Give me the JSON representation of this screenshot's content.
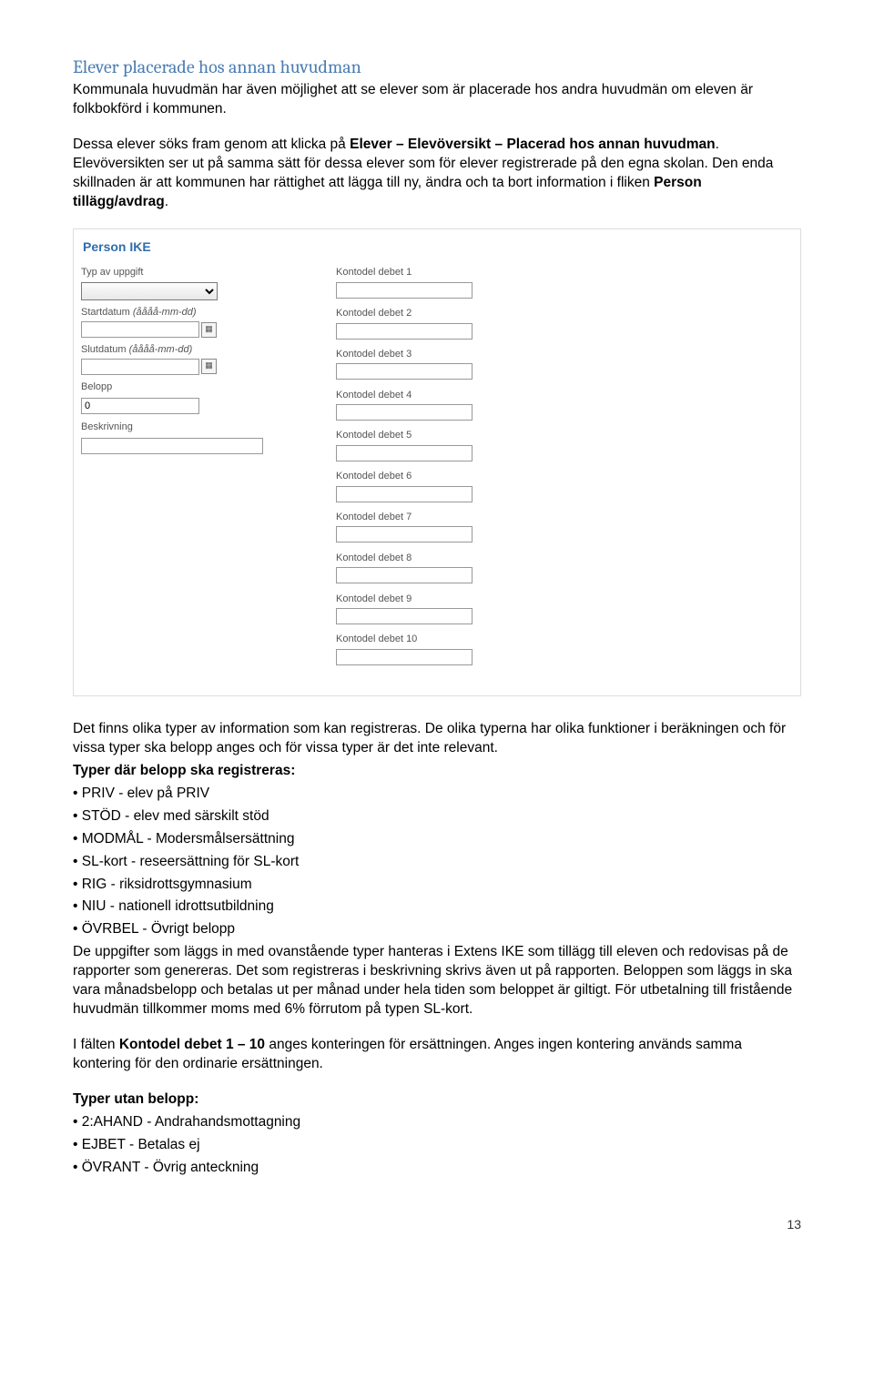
{
  "heading": "Elever placerade hos annan huvudman",
  "intro": "Kommunala huvudmän har även möjlighet att se elever som är placerade hos andra huvudmän om eleven är folkbokförd i kommunen.",
  "para_instructions_1": "Dessa elever söks fram genom att klicka på ",
  "para_instructions_bold": "Elever – Elevöversikt – Placerad hos annan huvudman",
  "para_instructions_2": ". Elevöversikten ser ut på samma sätt för dessa elever som för elever registrerade på den egna skolan. Den enda skillnaden är att kommunen har rättighet att lägga till ny, ändra och ta bort information i fliken ",
  "para_instructions_bold2": "Person tillägg/avdrag",
  "para_instructions_3": ".",
  "form": {
    "title": "Person IKE",
    "left": {
      "typ_label": "Typ av uppgift",
      "start_label": "Startdatum",
      "start_hint": "(åååå-mm-dd)",
      "slut_label": "Slutdatum",
      "slut_hint": "(åååå-mm-dd)",
      "belopp_label": "Belopp",
      "belopp_value": "0",
      "beskr_label": "Beskrivning"
    },
    "right_labels": [
      "Kontodel debet 1",
      "Kontodel debet 2",
      "Kontodel debet 3",
      "Kontodel debet 4",
      "Kontodel debet 5",
      "Kontodel debet 6",
      "Kontodel debet 7",
      "Kontodel debet 8",
      "Kontodel debet 9",
      "Kontodel debet 10"
    ]
  },
  "body1": "Det finns olika typer av information som kan registreras. De olika typerna har olika funktioner i beräkningen och för vissa typer ska belopp anges och för vissa typer är det inte relevant.",
  "body2_bold": "Typer där belopp ska registreras:",
  "bullets1": [
    "• PRIV - elev på PRIV",
    "• STÖD - elev med särskilt stöd",
    "• MODMÅL - Modersmålsersättning",
    "• SL-kort - reseersättning för SL-kort",
    "• RIG - riksidrottsgymnasium",
    "• NIU - nationell idrottsutbildning",
    "• ÖVRBEL - Övrigt belopp"
  ],
  "body3": "De uppgifter som läggs in med ovanstående typer hanteras i Extens IKE som tillägg till eleven och redovisas på de rapporter som genereras. Det som registreras i beskrivning skrivs även ut på rapporten. Beloppen som läggs in ska vara månadsbelopp och betalas ut per månad under hela tiden som beloppet är giltigt. För utbetalning till fristående huvudmän tillkommer moms med 6% förrutom på typen SL-kort.",
  "body4_a": "I fälten ",
  "body4_bold": "Kontodel debet 1 – 10",
  "body4_b": " anges konteringen för ersättningen. Anges ingen kontering används samma kontering för den ordinarie ersättningen.",
  "body5_bold": "Typer utan belopp:",
  "bullets2": [
    "• 2:AHAND - Andrahandsmottagning",
    "• EJBET - Betalas ej",
    "• ÖVRANT - Övrig anteckning"
  ],
  "page_number": "13"
}
